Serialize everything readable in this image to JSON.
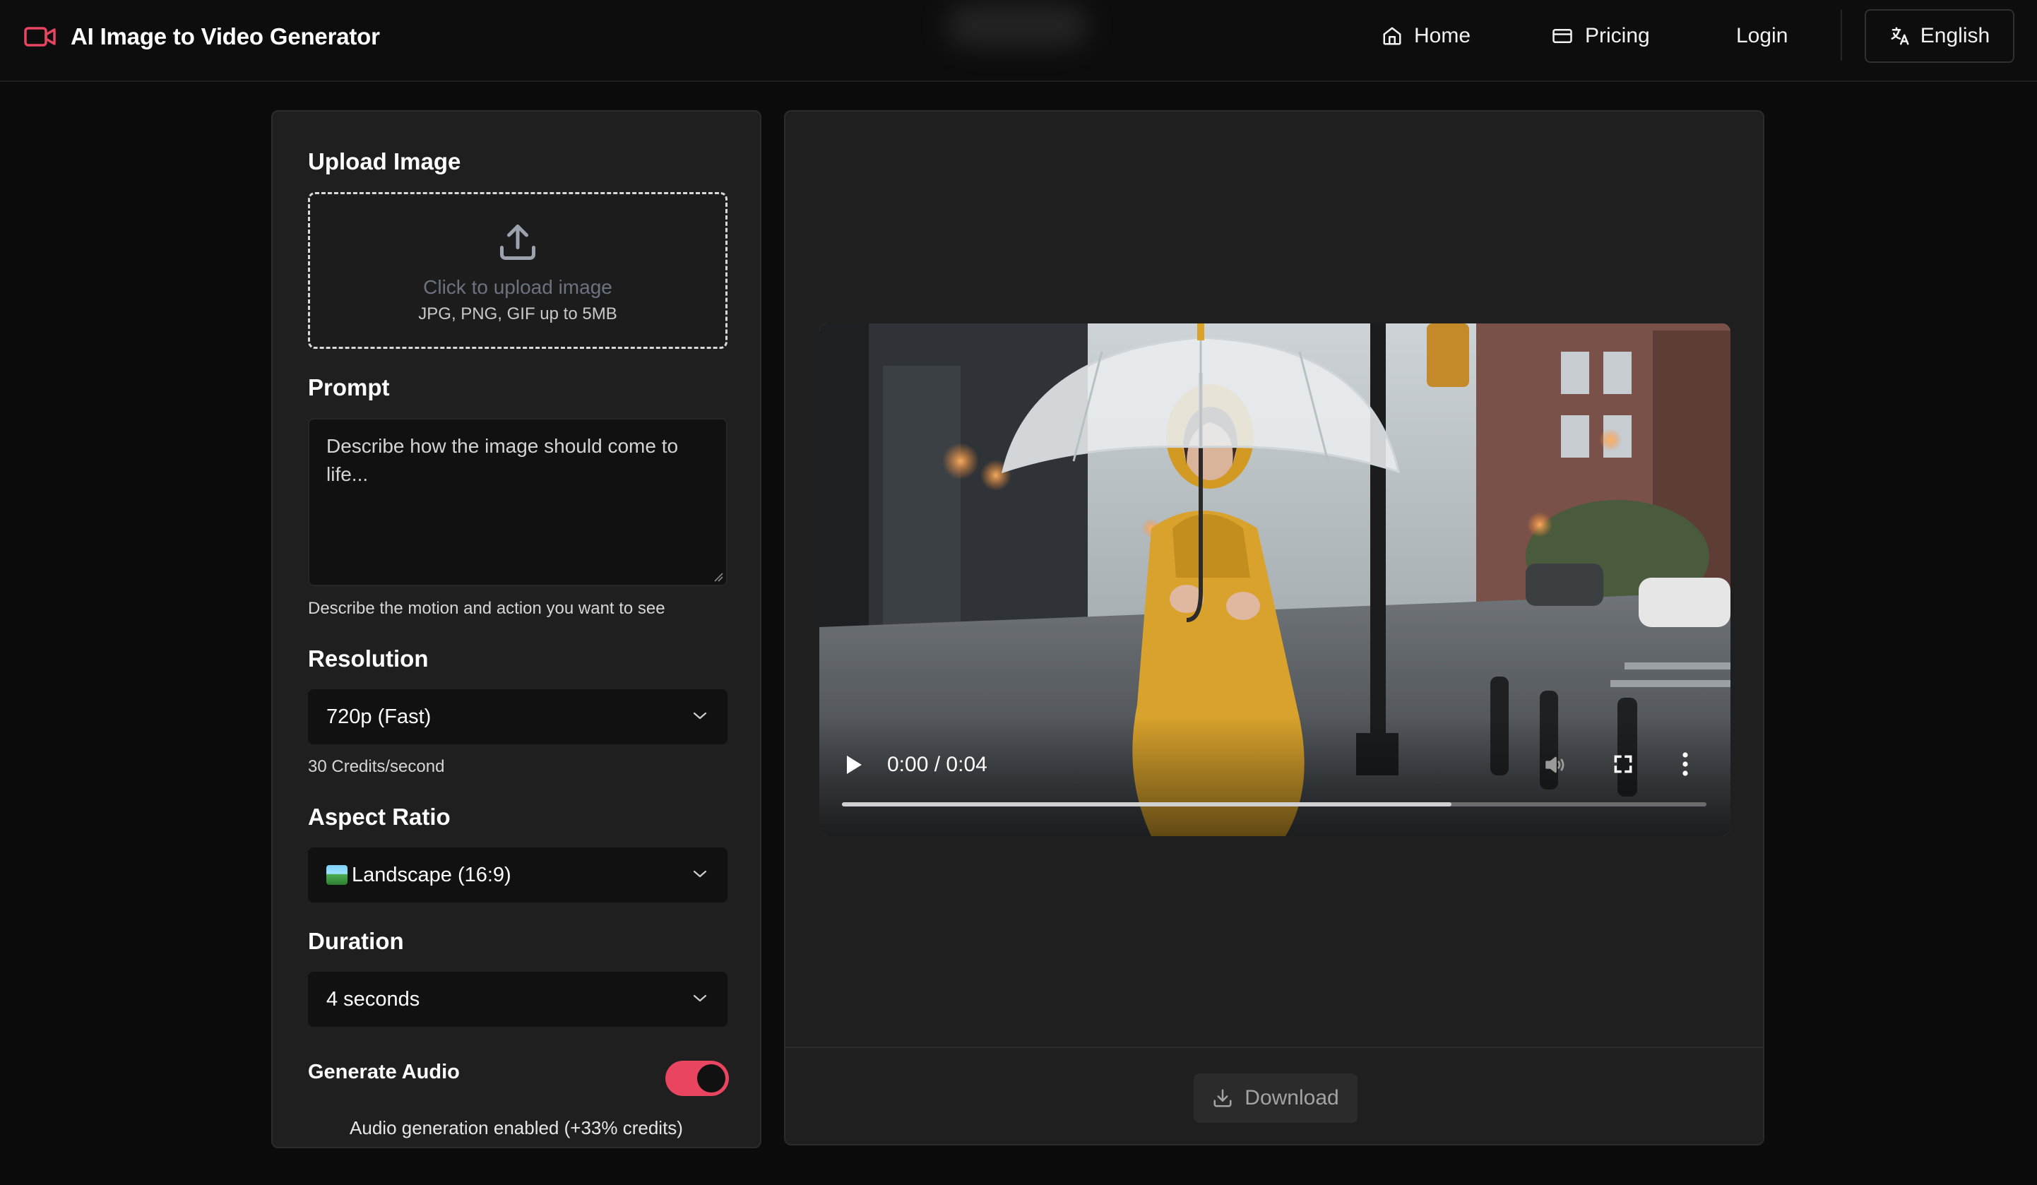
{
  "colors": {
    "accent": "#e94460",
    "background": "#0b0b0b",
    "panel": "#1f1f1f",
    "input": "#111111"
  },
  "header": {
    "app_title": "AI Image to Video Generator",
    "brand_icon": "video-camera-icon",
    "nav": [
      {
        "label": "Home",
        "icon": "home-icon"
      },
      {
        "label": "Pricing",
        "icon": "credit-card-icon"
      },
      {
        "label": "Login"
      }
    ],
    "language": {
      "label": "English",
      "icon": "translate-icon"
    }
  },
  "form": {
    "upload": {
      "title": "Upload Image",
      "main_text": "Click to upload image",
      "sub_text": "JPG, PNG, GIF up to 5MB",
      "icon": "upload-icon"
    },
    "prompt": {
      "title": "Prompt",
      "placeholder": "Describe how the image should come to life...",
      "value": "",
      "helper": "Describe the motion and action you want to see"
    },
    "resolution": {
      "title": "Resolution",
      "selected": "720p (Fast)",
      "helper": "30 Credits/second"
    },
    "aspect_ratio": {
      "title": "Aspect Ratio",
      "selected": "Landscape (16:9)",
      "icon": "framed-picture-icon"
    },
    "duration": {
      "title": "Duration",
      "selected": "4 seconds"
    },
    "audio": {
      "label": "Generate Audio",
      "enabled": true,
      "note": "Audio generation enabled (+33% credits)"
    }
  },
  "preview": {
    "video": {
      "current_time": "0:00",
      "separator": "/",
      "total_time": "0:04",
      "progress": 0.705,
      "controls": [
        "play-icon",
        "volume-icon",
        "fullscreen-icon",
        "more-options-icon"
      ]
    },
    "download_label": "Download"
  }
}
